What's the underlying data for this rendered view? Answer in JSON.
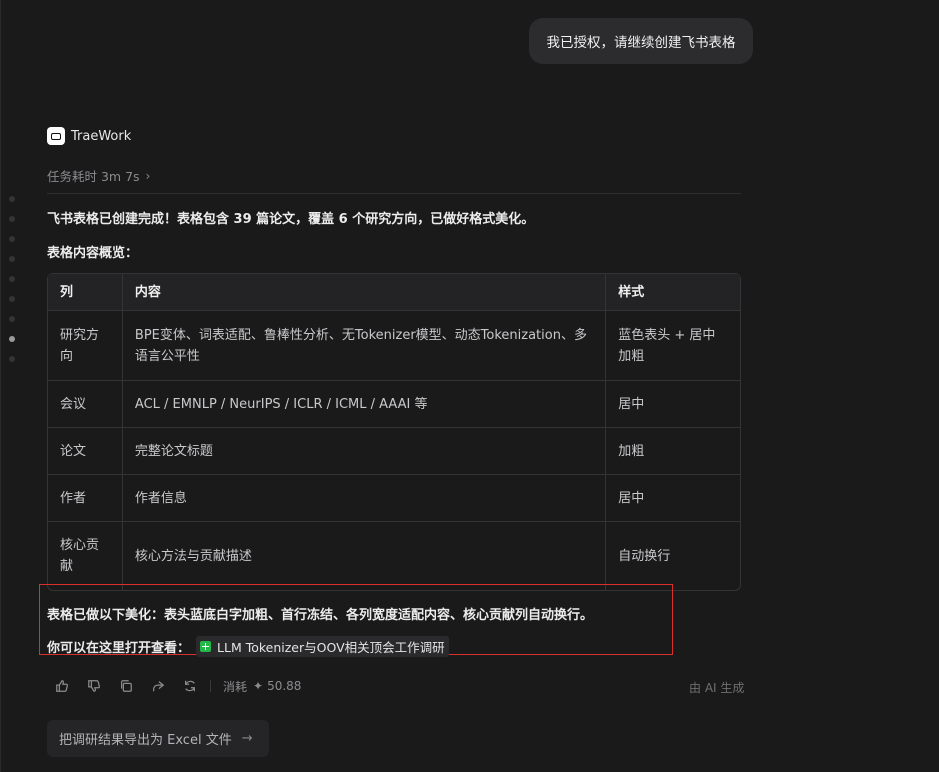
{
  "user_message": "我已授权，请继续创建飞书表格",
  "agent": {
    "name": "TraeWork",
    "timing_label": "任务耗时 3m 7s"
  },
  "reply": {
    "line1_a": "飞书表格已创建完成！表格包含 ",
    "line1_b": "39 篇论文",
    "line1_c": "，覆盖 6 个研究方向，已做好格式美化。",
    "overview_title": "表格内容概览："
  },
  "table": {
    "headers": [
      "列",
      "内容",
      "样式"
    ],
    "rows": [
      [
        "研究方向",
        "BPE变体、词表适配、鲁棒性分析、无Tokenizer模型、动态Tokenization、多语言公平性",
        "蓝色表头 + 居中加粗"
      ],
      [
        "会议",
        "ACL / EMNLP / NeurIPS / ICLR / ICML / AAAI 等",
        "居中"
      ],
      [
        "论文",
        "完整论文标题",
        "加粗"
      ],
      [
        "作者",
        "作者信息",
        "居中"
      ],
      [
        "核心贡献",
        "核心方法与贡献描述",
        "自动换行"
      ]
    ]
  },
  "summary": {
    "beautify": "表格已做以下美化：表头蓝底白字加粗、首行冻结、各列宽度适配内容、核心贡献列自动换行。",
    "open_prefix": "你可以在这里打开查看：",
    "doc_link": "LLM Tokenizer与OOV相关顶会工作调研"
  },
  "actions": {
    "consume_label": "消耗",
    "consume_value": "50.88",
    "ai_generated": "由 AI 生成"
  },
  "suggestion": "把调研结果导出为 Excel 文件",
  "colors": {
    "highlight_box": "#d9302b",
    "sheet_icon": "#22b94a"
  }
}
